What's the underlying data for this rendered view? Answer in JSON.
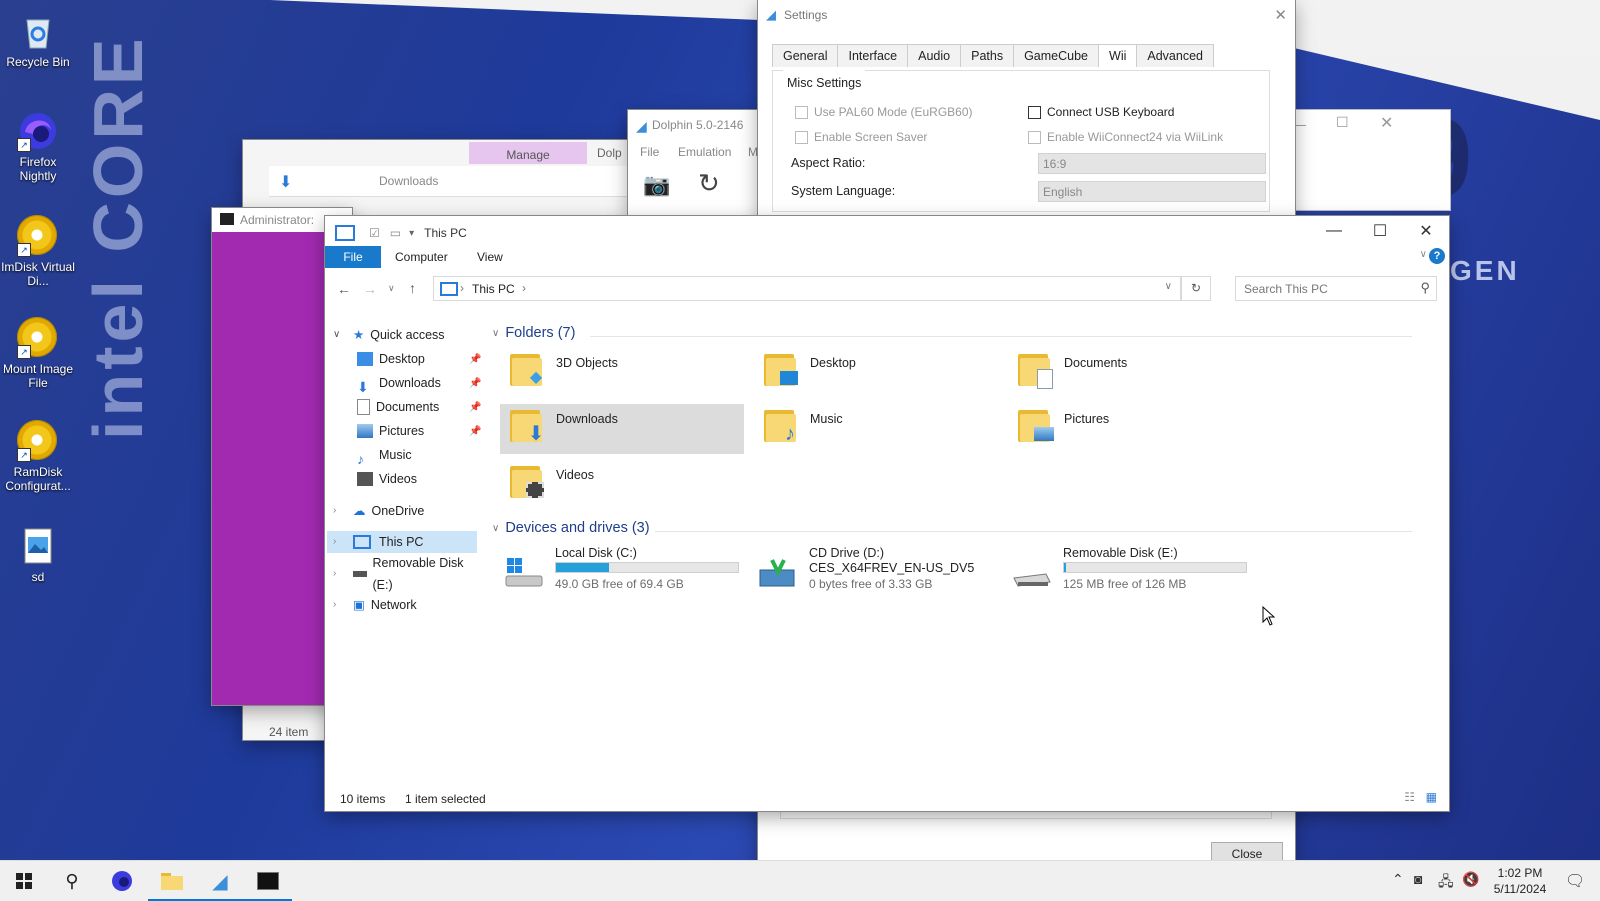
{
  "desktop": {
    "wallpaper_brand": "intel CORE",
    "wallpaper_number": "19",
    "wallpaper_gen": "GEN",
    "icons": [
      {
        "label": "Recycle Bin",
        "icon": "recycle-bin-icon"
      },
      {
        "label": "Firefox Nightly",
        "icon": "firefox-nightly-icon"
      },
      {
        "label": "ImDisk Virtual Di...",
        "icon": "disc-icon"
      },
      {
        "label": "Mount Image File",
        "icon": "disc-icon"
      },
      {
        "label": "RamDisk Configurat...",
        "icon": "disc-icon"
      },
      {
        "label": "sd",
        "icon": "image-file-icon"
      }
    ]
  },
  "bg_windows": {
    "downloads_title": "Downloads",
    "manage_tab": "Manage",
    "admin_title": "Administrator:",
    "items_count": "24 item",
    "dolphin_title": "Dolphin 5.0-2146",
    "dolphin_menu": [
      "File",
      "Emulation",
      "M"
    ],
    "dolphin_frag": "Dolp"
  },
  "settings": {
    "title": "Settings",
    "tabs": [
      "General",
      "Interface",
      "Audio",
      "Paths",
      "GameCube",
      "Wii",
      "Advanced"
    ],
    "active_tab": "Wii",
    "group_title": "Misc Settings",
    "pal60": "Use PAL60 Mode (EuRGB60)",
    "screensaver": "Enable Screen Saver",
    "usb_keyboard": "Connect USB Keyboard",
    "wiiconnect": "Enable WiiConnect24 via WiiLink",
    "aspect_label": "Aspect Ratio:",
    "aspect_value": "16:9",
    "language_label": "System Language:",
    "language_value": "English",
    "close_button": "Close"
  },
  "explorer": {
    "title": "This PC",
    "ribbon_tabs": [
      "File",
      "Computer",
      "View"
    ],
    "address": "This PC",
    "search_placeholder": "Search This PC",
    "nav": {
      "quick_access": "Quick access",
      "quick_items": [
        "Desktop",
        "Downloads",
        "Documents",
        "Pictures",
        "Music",
        "Videos"
      ],
      "onedrive": "OneDrive",
      "this_pc": "This PC",
      "removable": "Removable Disk (E:)",
      "network": "Network"
    },
    "folders_header": "Folders (7)",
    "folders": [
      "3D Objects",
      "Desktop",
      "Documents",
      "Downloads",
      "Music",
      "Pictures",
      "Videos"
    ],
    "selected_folder": "Downloads",
    "drives_header": "Devices and drives (3)",
    "drives": [
      {
        "name": "Local Disk (C:)",
        "sub": "",
        "free": "49.0 GB free of 69.4 GB",
        "used_fraction": 0.29
      },
      {
        "name": "CD Drive (D:)",
        "sub": "CES_X64FREV_EN-US_DV5",
        "free": "0 bytes free of 3.33 GB",
        "used_fraction": null
      },
      {
        "name": "Removable Disk (E:)",
        "sub": "",
        "free": "125 MB free of 126 MB",
        "used_fraction": 0.01
      }
    ],
    "status_items": "10 items",
    "status_selected": "1 item selected"
  },
  "taskbar": {
    "time": "1:02 PM",
    "date": "5/11/2024"
  },
  "colors": {
    "accent": "#0078d4",
    "drive_bar": "#26a0da",
    "selection": "#dcdcdc"
  }
}
